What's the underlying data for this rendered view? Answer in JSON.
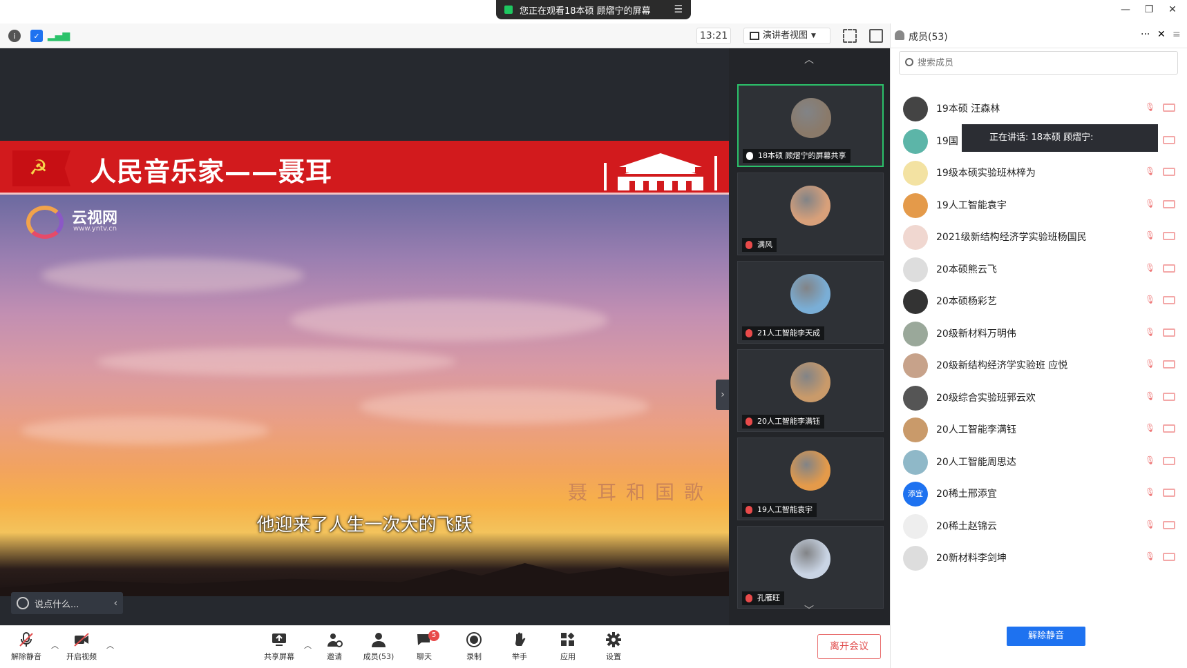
{
  "window": {
    "share_banner": "您正在观看18本硕 顾熠宁的屏幕",
    "time": "13:21",
    "view_mode": "演讲者视图"
  },
  "slide": {
    "title": "人民音乐家——聂耳",
    "logo_text": "云视网",
    "logo_url": "www.yntv.cn",
    "watermark": "聂耳和国歌",
    "subtitle": "他迎来了人生一次大的飞跃"
  },
  "chat": {
    "placeholder": "说点什么..."
  },
  "thumbnails": [
    {
      "name": "18本硕 顾熠宁的屏幕共享",
      "mic": "on",
      "avatar_color": "#8a7a6a"
    },
    {
      "name": "满风",
      "mic": "muted",
      "avatar_color": "#d8a07a"
    },
    {
      "name": "21人工智能李天成",
      "mic": "muted",
      "avatar_color": "#7aaed6"
    },
    {
      "name": "20人工智能李满钰",
      "mic": "muted",
      "avatar_color": "#c99a6a"
    },
    {
      "name": "19人工智能袁宇",
      "mic": "muted",
      "avatar_color": "#e49a4a"
    },
    {
      "name": "孔雁旺",
      "mic": "muted",
      "avatar_color": "#c9d4e4"
    }
  ],
  "panel": {
    "title": "成员(53)",
    "search_placeholder": "搜索成员",
    "speaking": "正在讲话: 18本硕 顾熠宁:",
    "unmute_all": "解除静音",
    "members": [
      {
        "name": "19本硕 汪森林",
        "avatar_color": "#444"
      },
      {
        "name": "19国",
        "avatar_color": "#5cb5a8"
      },
      {
        "name": "19级本硕实验班林梓为",
        "avatar_color": "#f3e2a2"
      },
      {
        "name": "19人工智能袁宇",
        "avatar_color": "#e49a4a"
      },
      {
        "name": "2021级新结构经济学实验班杨国民",
        "avatar_color": "#f0d7d0"
      },
      {
        "name": "20本硕熊云飞",
        "avatar_color": "#ddd"
      },
      {
        "name": "20本硕杨彩艺",
        "avatar_color": "#333"
      },
      {
        "name": "20级新材料万明伟",
        "avatar_color": "#9aa89a"
      },
      {
        "name": "20级新结构经济学实验班 应悦",
        "avatar_color": "#c7a28a"
      },
      {
        "name": "20级综合实验班郭云欢",
        "avatar_color": "#555"
      },
      {
        "name": "20人工智能李满钰",
        "avatar_color": "#c99a6a"
      },
      {
        "name": "20人工智能周思达",
        "avatar_color": "#8fb8c8"
      },
      {
        "name": "20稀土邢添宜",
        "avatar_color": "#1e72f0",
        "avatar_text": "添宜"
      },
      {
        "name": "20稀土赵锦云",
        "avatar_color": "#eee"
      },
      {
        "name": "20新材料李剑坤",
        "avatar_color": "#ddd"
      }
    ]
  },
  "bottombar": {
    "unmute": "解除静音",
    "video": "开启视频",
    "share": "共享屏幕",
    "invite": "邀请",
    "members": "成员(53)",
    "chat": "聊天",
    "chat_badge": "5",
    "record": "录制",
    "raise_hand": "举手",
    "apps": "应用",
    "settings": "设置",
    "leave": "离开会议"
  }
}
